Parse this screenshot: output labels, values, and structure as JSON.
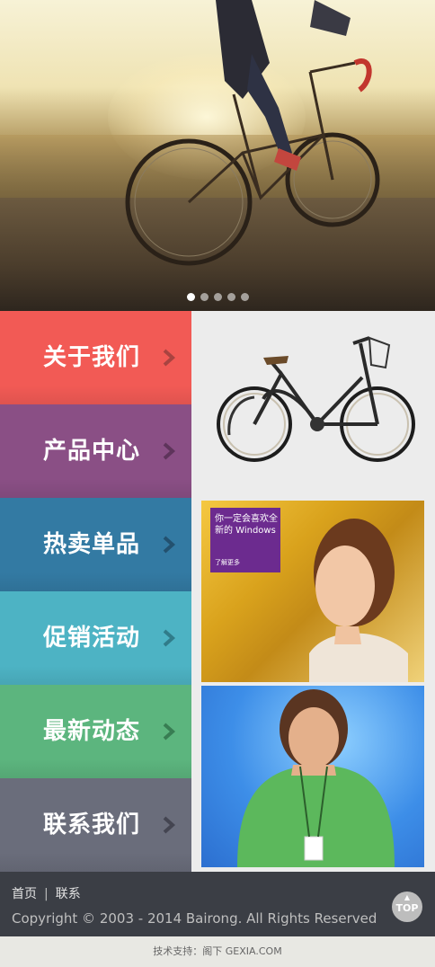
{
  "hero": {
    "slides": 5,
    "active_slide": 1
  },
  "menu": {
    "items": [
      {
        "label": "关于我们",
        "color": "#f25a55"
      },
      {
        "label": "产品中心",
        "color": "#8a4f85"
      },
      {
        "label": "热卖单品",
        "color": "#337aa3"
      },
      {
        "label": "促销活动",
        "color": "#4db3c4"
      },
      {
        "label": "最新动态",
        "color": "#5cb57e"
      },
      {
        "label": "联系我们",
        "color": "#6a6d7b"
      }
    ]
  },
  "tiles": {
    "promo_title": "你一定会喜欢全新的 Windows",
    "promo_more": "了解更多"
  },
  "footer": {
    "nav_home": "首页",
    "nav_separator": "|",
    "nav_contact": "联系",
    "copyright": "Copyright © 2003 - 2014 Bairong. All Rights Reserved",
    "top_label": "TOP"
  },
  "bottom_bar": {
    "text": "技术支持：阁下 GEXIA.COM"
  }
}
